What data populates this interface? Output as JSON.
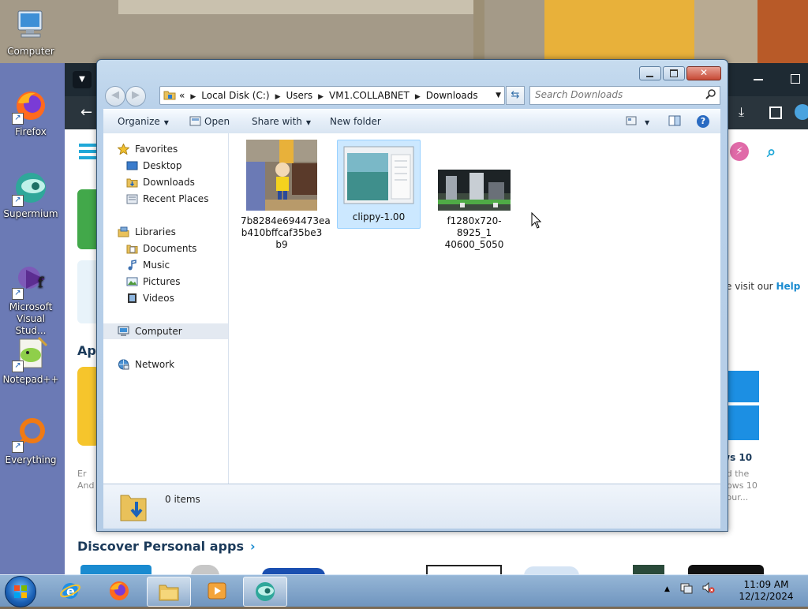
{
  "desktop": {
    "icons": [
      {
        "label": "Computer",
        "icon": "computer-icon"
      },
      {
        "label": "Firefox",
        "icon": "firefox-icon"
      },
      {
        "label": "Supermium",
        "icon": "supermium-icon"
      },
      {
        "label": "Microsoft Visual Stud...",
        "icon": "visual-studio-icon"
      },
      {
        "label": "Notepad++",
        "icon": "notepadplusplus-icon"
      },
      {
        "label": "Everything",
        "icon": "everything-icon"
      }
    ]
  },
  "background_browser": {
    "apps_heading": "App",
    "left_text": "Er\nAnd",
    "help_text": "e visit our ",
    "help_link": "Help",
    "win10_title": "ws 10",
    "win10_desc_1": "ad the",
    "win10_desc_2": "dows 10",
    "win10_desc_3": "your...",
    "discover_heading": "Discover Personal apps"
  },
  "explorer": {
    "address": {
      "overflow": "«",
      "crumbs": [
        "Local Disk (C:)",
        "Users",
        "VM1.COLLABNET",
        "Downloads"
      ]
    },
    "search_placeholder": "Search Downloads",
    "commands": {
      "organize": "Organize",
      "open": "Open",
      "share_with": "Share with",
      "new_folder": "New folder"
    },
    "nav": {
      "favorites": "Favorites",
      "desktop": "Desktop",
      "downloads": "Downloads",
      "recent_places": "Recent Places",
      "libraries": "Libraries",
      "documents": "Documents",
      "music": "Music",
      "pictures": "Pictures",
      "videos": "Videos",
      "computer": "Computer",
      "network": "Network"
    },
    "files": [
      {
        "name_lines": [
          "7b8284e694473ea",
          "b410bffcaf35be3",
          "b9"
        ],
        "selected": false
      },
      {
        "name_lines": [
          "clippy-1.00"
        ],
        "selected": true
      },
      {
        "name_lines": [
          "f1280x720-8925_1",
          "40600_5050"
        ],
        "selected": false
      }
    ],
    "details": {
      "count": "0 items"
    }
  },
  "taskbar": {
    "apps": [
      "start-orb",
      "internet-explorer-icon",
      "firefox-icon",
      "file-explorer-icon",
      "media-player-icon",
      "supermium-icon"
    ],
    "active_app": "file-explorer-icon",
    "clock_time": "11:09 AM",
    "clock_date": "12/12/2024",
    "tray_arrow": "▲"
  },
  "colors": {
    "accent": "#1a8bd0",
    "selection": "#cce8ff",
    "window_frame": "#b9d1ea"
  }
}
